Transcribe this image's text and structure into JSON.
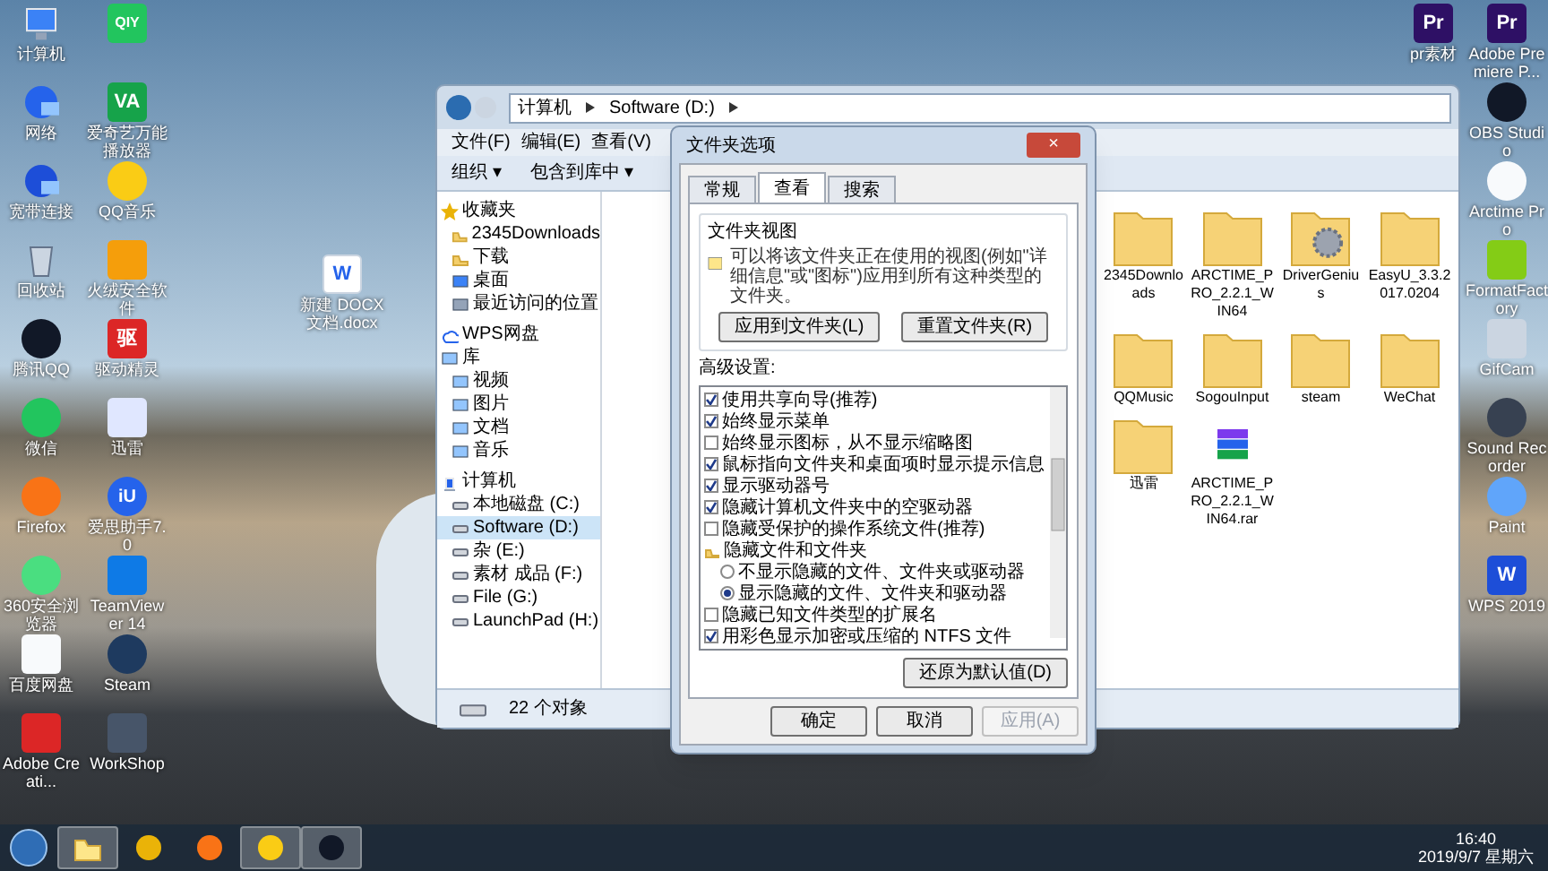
{
  "desktop_column_1": [
    {
      "label": "计算机",
      "kind": "computer",
      "color": "#3b82f6"
    },
    {
      "label": "网络",
      "kind": "network",
      "color": "#2563eb"
    },
    {
      "label": "宽带连接",
      "kind": "network",
      "color": "#1d4ed8"
    },
    {
      "label": "回收站",
      "kind": "recycle",
      "color": "#cbd5e1"
    },
    {
      "label": "腾讯QQ",
      "kind": "round",
      "color": "#111827"
    },
    {
      "label": "微信",
      "kind": "round",
      "color": "#22c55e"
    },
    {
      "label": "Firefox",
      "kind": "round",
      "color": "#f97316"
    },
    {
      "label": "360安全浏览器",
      "kind": "round",
      "color": "#4ade80"
    },
    {
      "label": "百度网盘",
      "kind": "app",
      "color": "#f8fafc"
    },
    {
      "label": "Adobe Creati...",
      "kind": "app",
      "color": "#dc2626"
    }
  ],
  "desktop_column_2": [
    {
      "kind": "app",
      "color": "#22c55e",
      "glyph": "QIY"
    },
    {
      "label": "爱奇艺万能播放器",
      "kind": "app",
      "color": "#16a34a",
      "glyph": "VA"
    },
    {
      "label": "QQ音乐",
      "kind": "round",
      "color": "#facc15"
    },
    {
      "label": "火绒安全软件",
      "kind": "app",
      "color": "#f59e0b"
    },
    {
      "label": "驱动精灵",
      "kind": "app",
      "color": "#dc2626",
      "glyph": "驱"
    },
    {
      "label": "迅雷",
      "kind": "app",
      "color": "#e0e7ff"
    },
    {
      "label": "爱思助手7.0",
      "kind": "round",
      "color": "#2563eb",
      "glyph": "iU"
    },
    {
      "label": "TeamViewer 14",
      "kind": "app",
      "color": "#0e7ae6"
    },
    {
      "label": "Steam",
      "kind": "round",
      "color": "#1e3a5f"
    },
    {
      "label": "WorkShop",
      "kind": "app",
      "color": "#475569"
    }
  ],
  "desktop_doc": {
    "label": "新建 DOCX 文档.docx",
    "kind": "doc",
    "color": "#2563eb",
    "glyph": "W"
  },
  "desktop_right_column_1": [
    {
      "label": "pr素材",
      "kind": "app",
      "color": "#2e1065",
      "glyph": "Pr"
    }
  ],
  "desktop_right_column_2": [
    {
      "label": "Adobe Premiere P...",
      "kind": "app",
      "color": "#2e1065",
      "glyph": "Pr"
    },
    {
      "label": "OBS Studio",
      "kind": "round",
      "color": "#111827"
    },
    {
      "label": "Arctime Pro",
      "kind": "round",
      "color": "#f8fafc"
    },
    {
      "label": "FormatFactory",
      "kind": "app",
      "color": "#84cc16"
    },
    {
      "label": "GifCam",
      "kind": "app",
      "color": "#cbd5e1"
    },
    {
      "label": "Sound Recorder",
      "kind": "round",
      "color": "#374151"
    },
    {
      "label": "Paint",
      "kind": "round",
      "color": "#60a5fa"
    },
    {
      "label": "WPS 2019",
      "kind": "app",
      "color": "#1d4ed8",
      "glyph": "W"
    }
  ],
  "explorer": {
    "address": [
      "计算机",
      "Software (D:)"
    ],
    "menu": [
      "文件(F)",
      "编辑(E)",
      "查看(V)"
    ],
    "toolbar": [
      "组织 ▾",
      "包含到库中 ▾"
    ],
    "nav": [
      {
        "label": "收藏夹",
        "kind": "star",
        "selected": false,
        "children": [
          {
            "label": "2345Downloads",
            "kind": "folder",
            "selected": false
          },
          {
            "label": "下载",
            "kind": "folder",
            "selected": false
          },
          {
            "label": "桌面",
            "kind": "desktop",
            "selected": false
          },
          {
            "label": "最近访问的位置",
            "kind": "recent",
            "selected": false
          }
        ]
      },
      {
        "label": "WPS网盘",
        "kind": "cloud",
        "selected": false
      },
      {
        "label": "库",
        "kind": "library",
        "selected": false,
        "children": [
          {
            "label": "视频",
            "kind": "library",
            "selected": false
          },
          {
            "label": "图片",
            "kind": "library",
            "selected": false
          },
          {
            "label": "文档",
            "kind": "library",
            "selected": false
          },
          {
            "label": "音乐",
            "kind": "library",
            "selected": false
          }
        ]
      },
      {
        "label": "计算机",
        "kind": "computer",
        "selected": false,
        "children": [
          {
            "label": "本地磁盘 (C:)",
            "kind": "drive",
            "selected": false
          },
          {
            "label": "Software (D:)",
            "kind": "drive",
            "selected": true
          },
          {
            "label": "杂 (E:)",
            "kind": "drive",
            "selected": false
          },
          {
            "label": "素材 成品 (F:)",
            "kind": "drive",
            "selected": false
          },
          {
            "label": "File (G:)",
            "kind": "drive",
            "selected": false
          },
          {
            "label": "LaunchPad (H:)",
            "kind": "drive",
            "selected": false
          }
        ]
      }
    ],
    "files": [
      {
        "label": "2345Downloads",
        "kind": "folder"
      },
      {
        "label": "ARCTIME_PRO_2.2.1_WIN64",
        "kind": "folder"
      },
      {
        "label": "DriverGenius",
        "kind": "gear-folder"
      },
      {
        "label": "EasyU_3.3.2017.0204",
        "kind": "folder"
      },
      {
        "label": "QQMusic",
        "kind": "folder"
      },
      {
        "label": "SogouInput",
        "kind": "folder"
      },
      {
        "label": "steam",
        "kind": "folder"
      },
      {
        "label": "WeChat",
        "kind": "folder"
      },
      {
        "label": "迅雷",
        "kind": "folder"
      },
      {
        "label": "ARCTIME_PRO_2.2.1_WIN64.rar",
        "kind": "archive"
      }
    ],
    "status": "22 个对象"
  },
  "dialog": {
    "title": "文件夹选项",
    "close": "×",
    "tabs": [
      {
        "label": "常规",
        "selected": false
      },
      {
        "label": "查看",
        "selected": true
      },
      {
        "label": "搜索",
        "selected": false
      }
    ],
    "group_title": "文件夹视图",
    "group_text": "可以将该文件夹正在使用的视图(例如\"详细信息\"或\"图标\")应用到所有这种类型的文件夹。",
    "group_buttons": [
      "应用到文件夹(L)",
      "重置文件夹(R)"
    ],
    "advanced_title": "高级设置:",
    "settings": [
      {
        "label": "使用共享向导(推荐)",
        "kind": "checkbox",
        "checked": true
      },
      {
        "label": "始终显示菜单",
        "kind": "checkbox",
        "checked": true
      },
      {
        "label": "始终显示图标，从不显示缩略图",
        "kind": "checkbox",
        "checked": false
      },
      {
        "label": "鼠标指向文件夹和桌面项时显示提示信息",
        "kind": "checkbox",
        "checked": true
      },
      {
        "label": "显示驱动器号",
        "kind": "checkbox",
        "checked": true
      },
      {
        "label": "隐藏计算机文件夹中的空驱动器",
        "kind": "checkbox",
        "checked": true
      },
      {
        "label": "隐藏受保护的操作系统文件(推荐)",
        "kind": "checkbox",
        "checked": false
      },
      {
        "label": "隐藏文件和文件夹",
        "kind": "folder",
        "children": [
          {
            "label": "不显示隐藏的文件、文件夹或驱动器",
            "kind": "radio",
            "selected": false
          },
          {
            "label": "显示隐藏的文件、文件夹和驱动器",
            "kind": "radio",
            "selected": true
          }
        ]
      },
      {
        "label": "隐藏已知文件类型的扩展名",
        "kind": "checkbox",
        "checked": false
      },
      {
        "label": "用彩色显示加密或压缩的 NTFS 文件",
        "kind": "checkbox",
        "checked": true
      }
    ],
    "restore_button": "还原为默认值(D)",
    "buttons": [
      {
        "label": "确定",
        "disabled": false
      },
      {
        "label": "取消",
        "disabled": false
      },
      {
        "label": "应用(A)",
        "disabled": true
      }
    ]
  },
  "taskbar": {
    "apps": [
      {
        "kind": "folder",
        "color": "#fde68a",
        "selected": true
      },
      {
        "kind": "round",
        "color": "#eab308",
        "selected": false
      },
      {
        "kind": "round",
        "color": "#f97316",
        "selected": false
      },
      {
        "kind": "round",
        "color": "#facc15",
        "selected": true
      },
      {
        "kind": "round",
        "color": "#111827",
        "selected": true
      }
    ],
    "time": "16:40",
    "date": "2019/9/7 星期六"
  }
}
